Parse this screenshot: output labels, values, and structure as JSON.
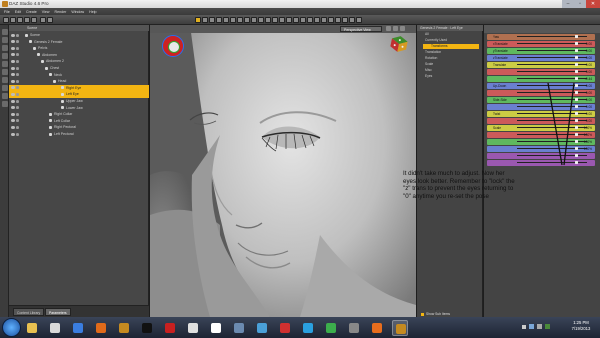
{
  "window": {
    "title": "DAZ Studio 4.6 Pro"
  },
  "menu": [
    "File",
    "Edit",
    "Create",
    "View",
    "Render",
    "Window",
    "Help"
  ],
  "scene": {
    "tab": "Scene",
    "rows": [
      {
        "label": "Scene",
        "indent": 12,
        "selected": false
      },
      {
        "label": "Genesis 2 Female",
        "indent": 16,
        "selected": false
      },
      {
        "label": "Pelvis",
        "indent": 20,
        "selected": false
      },
      {
        "label": "Abdomen",
        "indent": 24,
        "selected": false
      },
      {
        "label": "Abdomen 2",
        "indent": 28,
        "selected": false
      },
      {
        "label": "Chest",
        "indent": 32,
        "selected": false
      },
      {
        "label": "Neck",
        "indent": 36,
        "selected": false
      },
      {
        "label": "Head",
        "indent": 40,
        "selected": false
      },
      {
        "label": "Right Eye",
        "indent": 48,
        "selected": true
      },
      {
        "label": "Left Eye",
        "indent": 48,
        "selected": true
      },
      {
        "label": "Upper Jaw",
        "indent": 48,
        "selected": false
      },
      {
        "label": "Lower Jaw",
        "indent": 48,
        "selected": false
      },
      {
        "label": "Right Collar",
        "indent": 36,
        "selected": false
      },
      {
        "label": "Left Collar",
        "indent": 36,
        "selected": false
      },
      {
        "label": "Right Pectoral",
        "indent": 36,
        "selected": false
      },
      {
        "label": "Left Pectoral",
        "indent": 36,
        "selected": false
      }
    ],
    "bottom_tabs": [
      "Content Library",
      "Parameters"
    ]
  },
  "viewport": {
    "camera": "Perspective View"
  },
  "params": {
    "header": "Genesis 2 Female : Left Eye",
    "rows": [
      {
        "label": "All",
        "selected": false
      },
      {
        "label": "Currently Used",
        "selected": false
      },
      {
        "label": "Transforms",
        "selected": true
      },
      {
        "label": "Translation",
        "selected": false
      },
      {
        "label": "Rotation",
        "selected": false
      },
      {
        "label": "Scale",
        "selected": false
      },
      {
        "label": "Misc",
        "selected": false
      },
      {
        "label": "Eyes",
        "selected": false
      }
    ],
    "show_sub": "Show Sub Items"
  },
  "sliders": [
    {
      "label": "Yaw",
      "color": "#b07050",
      "value": ""
    },
    {
      "label": "xTranslate",
      "color": "#cc5a5a",
      "value": "0.00"
    },
    {
      "label": "yTranslate",
      "color": "#5fb85f",
      "value": "0.00"
    },
    {
      "label": "zTranslate",
      "color": "#6a7fd0",
      "value": "0.00"
    },
    {
      "label": "Translate",
      "color": "#cccc44",
      "value": "0.00"
    },
    {
      "label": "",
      "color": "#cc5a5a",
      "value": "0.00"
    },
    {
      "label": "",
      "color": "#5fb85f",
      "value": "-0.44"
    },
    {
      "label": "Up-Down",
      "color": "#6a7fd0",
      "value": "0.00"
    },
    {
      "label": "",
      "color": "#cc5a5a",
      "value": "0.00"
    },
    {
      "label": "Side-Side",
      "color": "#5fb85f",
      "value": "0.00"
    },
    {
      "label": "",
      "color": "#6a7fd0",
      "value": "0.00"
    },
    {
      "label": "Twist",
      "color": "#cccc44",
      "value": "0.00"
    },
    {
      "label": "",
      "color": "#cc5a5a",
      "value": "0.00"
    },
    {
      "label": "Scale",
      "color": "#cccc44",
      "value": "100%"
    },
    {
      "label": "",
      "color": "#cc5a5a",
      "value": "100%"
    },
    {
      "label": "",
      "color": "#5fb85f",
      "value": "100%"
    },
    {
      "label": "",
      "color": "#6a7fd0",
      "value": "100%"
    },
    {
      "label": "",
      "color": "#9a58b0",
      "value": ""
    },
    {
      "label": "",
      "color": "#9a58b0",
      "value": ""
    }
  ],
  "annotation": "It didn't take much to adjust. Now her eyes look better. Remember to \"lock\" the \"z\" trans to prevent the eyes returning to \"0\" anytime you re-set the pose",
  "taskbar": {
    "icons": [
      {
        "name": "explorer-icon",
        "color": "#e8c050"
      },
      {
        "name": "notepad-icon",
        "color": "#d9d9d9"
      },
      {
        "name": "media-player-icon",
        "color": "#3a7de0"
      },
      {
        "name": "firefox-icon",
        "color": "#e06a1a"
      },
      {
        "name": "daz-studio-icon",
        "color": "#c58a20"
      },
      {
        "name": "chess-icon",
        "color": "#111111"
      },
      {
        "name": "pdf-icon",
        "color": "#c82020"
      },
      {
        "name": "paint-icon",
        "color": "#e0e0e0"
      },
      {
        "name": "cards-icon",
        "color": "#ffffff"
      },
      {
        "name": "calculator-icon",
        "color": "#6b8ab0"
      },
      {
        "name": "paint-shop-icon",
        "color": "#4aa0d8"
      },
      {
        "name": "document-icon",
        "color": "#d03030"
      },
      {
        "name": "skype-icon",
        "color": "#2aa0e0"
      },
      {
        "name": "chrome-icon",
        "color": "#3cae4c"
      },
      {
        "name": "game-icon",
        "color": "#888888"
      },
      {
        "name": "firefox2-icon",
        "color": "#e86d1d"
      },
      {
        "name": "daz-active-icon",
        "color": "#c58a20"
      }
    ],
    "time": "1:25 PM",
    "date": "7/19/2013"
  }
}
